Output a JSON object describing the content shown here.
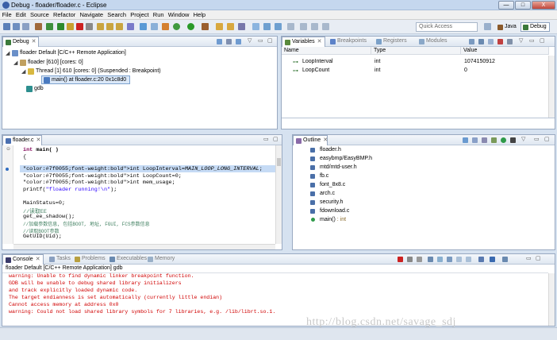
{
  "window": {
    "title": "Debug - floader/floader.c - Eclipse",
    "minimize": "—",
    "maximize": "□",
    "close": "X"
  },
  "menu": [
    "File",
    "Edit",
    "Source",
    "Refactor",
    "Navigate",
    "Search",
    "Project",
    "Run",
    "Window",
    "Help"
  ],
  "toolbar": {
    "quick_access_placeholder": "Quick Access",
    "perspectives": [
      {
        "label": "Java",
        "icon": "java-perspective-icon",
        "color": "#8b5a2b"
      },
      {
        "label": "Debug",
        "icon": "debug-perspective-icon",
        "color": "#3b7a3b"
      }
    ]
  },
  "debug_view": {
    "tab": "Debug",
    "tree": [
      {
        "label": "floader Default [C/C++ Remote Application]",
        "icon": "launch-icon"
      },
      {
        "label": "floader [610] [cores: 0]",
        "icon": "process-icon"
      },
      {
        "label": "Thread [1] 610 [cores: 0] (Suspended : Breakpoint)",
        "icon": "thread-icon"
      },
      {
        "label": "main() at floader.c:20 0x1c8d0",
        "icon": "stack-frame-icon"
      },
      {
        "label": "gdb",
        "icon": "gdb-icon"
      }
    ]
  },
  "variables_view": {
    "tabs": [
      "Variables",
      "Breakpoints",
      "Registers",
      "Modules"
    ],
    "columns": [
      "Name",
      "Type",
      "Value"
    ],
    "rows": [
      {
        "name": "LoopInterval",
        "type": "int",
        "value": "1074150912"
      },
      {
        "name": "LoopCount",
        "type": "int",
        "value": "0"
      }
    ]
  },
  "editor": {
    "tab": "floader.c",
    "lines": [
      "int main( )",
      "{",
      "",
      "int LoopInterval=MAIN_LOOP_LONG_INTERVAL;",
      "int LoopCount=0;",
      "int mem_usage;",
      "printf(\"floader running!\\n\");",
      "",
      "MainStatus=0;",
      "//读取EE",
      "get_ee_shadow();",
      "//加载参数信息, 包括BOOT, 地址, FGUI, FCS参数信息",
      "//读取BOOT参数",
      "GetUID(Uid);"
    ]
  },
  "outline_view": {
    "tab": "Outline",
    "items": [
      "floader.h",
      "easybmp/EasyBMP.h",
      "mtd/mtd-user.h",
      "fb.c",
      "font_8x8.c",
      "arch.c",
      "security.h",
      "fdownload.c",
      "main()"
    ],
    "main_type": " : int"
  },
  "console_view": {
    "tabs": [
      "Console",
      "Tasks",
      "Problems",
      "Executables",
      "Memory"
    ],
    "header": "floader Default [C/C++ Remote Application] gdb",
    "lines": [
      "warning: Unable to find dynamic linker breakpoint function.",
      "GDB will be unable to debug shared library initializers",
      "and track explicitly loaded dynamic code.",
      "The target endianness is set automatically (currently little endian)",
      "Cannot access memory at address 0x0",
      "warning: Could not load shared library symbols for 7 libraries, e.g. /lib/librt.so.1."
    ]
  },
  "watermark": "http://blog.csdn.net/savage_sdj"
}
